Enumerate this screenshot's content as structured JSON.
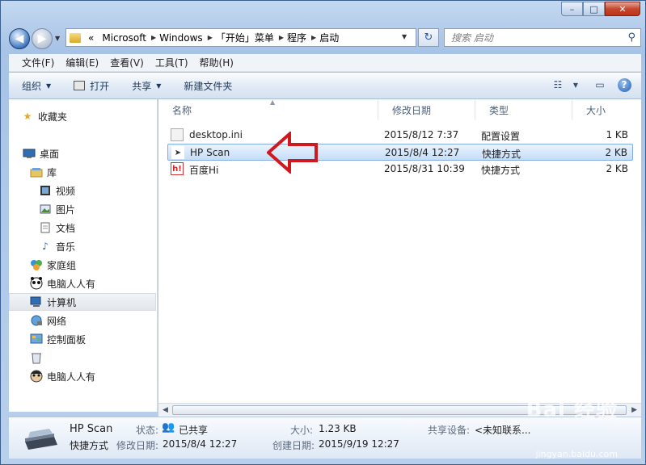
{
  "window": {
    "controls": [
      "–",
      "□",
      "✕"
    ]
  },
  "address": {
    "prefix": "«",
    "crumbs": [
      "Microsoft",
      "Windows",
      "「开始」菜单",
      "程序",
      "启动"
    ]
  },
  "search": {
    "placeholder": "搜索 启动"
  },
  "menu": [
    "文件(F)",
    "编辑(E)",
    "查看(V)",
    "工具(T)",
    "帮助(H)"
  ],
  "toolbar": {
    "organize": "组织",
    "open": "打开",
    "share": "共享",
    "new_folder": "新建文件夹"
  },
  "nav": {
    "favorites": "收藏夹",
    "desktop": "桌面",
    "libraries": "库",
    "videos": "视频",
    "pictures": "图片",
    "documents": "文档",
    "music": "音乐",
    "homegroup": "家庭组",
    "user1": "电脑人人有",
    "computer": "计算机",
    "network": "网络",
    "control_panel": "控制面板",
    "recycle": "",
    "user2": "电脑人人有"
  },
  "columns": {
    "name": "名称",
    "modified": "修改日期",
    "type": "类型",
    "size": "大小"
  },
  "files": [
    {
      "name": "desktop.ini",
      "modified": "2015/8/12 7:37",
      "type": "配置设置",
      "size": "1 KB",
      "icon": "ini-file-icon"
    },
    {
      "name": "HP Scan",
      "modified": "2015/8/4 12:27",
      "type": "快捷方式",
      "size": "2 KB",
      "icon": "hp-scan-icon"
    },
    {
      "name": "百度Hi",
      "modified": "2015/8/31 10:39",
      "type": "快捷方式",
      "size": "2 KB",
      "icon": "baidu-hi-icon"
    }
  ],
  "details": {
    "name": "HP Scan",
    "kind": "快捷方式",
    "state_label": "状态:",
    "state_value": "已共享",
    "modified_label": "修改日期:",
    "modified_value": "2015/8/4 12:27",
    "size_label": "大小:",
    "size_value": "1.23 KB",
    "created_label": "创建日期:",
    "created_value": "2015/9/19 12:27",
    "share_label": "共享设备:",
    "share_value": "<未知联系..."
  },
  "watermark": {
    "main": "Bai 经验",
    "sub": "jingyan.baidu.com"
  },
  "colors": {
    "accent": "#3f77c0",
    "selection": "#c4ddf8",
    "arrow": "#d0181e"
  }
}
